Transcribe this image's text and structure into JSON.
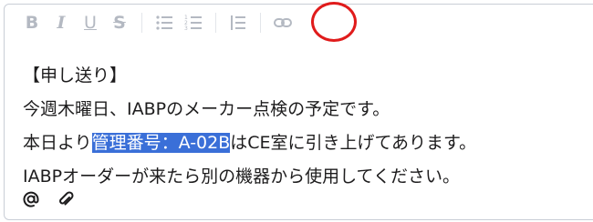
{
  "toolbar": {
    "bold_glyph": "B",
    "italic_glyph": "I",
    "underline_glyph": "U",
    "strike_glyph": "S",
    "items": [
      "bold-icon",
      "italic-icon",
      "underline-icon",
      "strikethrough-icon",
      "bullet-list-icon",
      "numbered-list-icon",
      "blockquote-icon",
      "link-icon"
    ]
  },
  "annotation": {
    "shape": "circle",
    "color": "#e01b1b",
    "target": "link-icon"
  },
  "message": {
    "line1": "【申し送り】",
    "line2": "今週木曜日、IABPのメーカー点検の予定です。",
    "line3_before": "本日より",
    "line3_selected": "管理番号：A-02B",
    "line3_after": "はCE室に引き上げてあります。",
    "line4": "IABPオーダーが来たら別の機器から使用してください。"
  },
  "colors": {
    "selection": "#3a6fd8",
    "toolbar_icon": "#b4b9c2",
    "text": "#1d1c1d"
  },
  "footer": {
    "items": [
      "mention-icon",
      "attachment-icon"
    ]
  }
}
